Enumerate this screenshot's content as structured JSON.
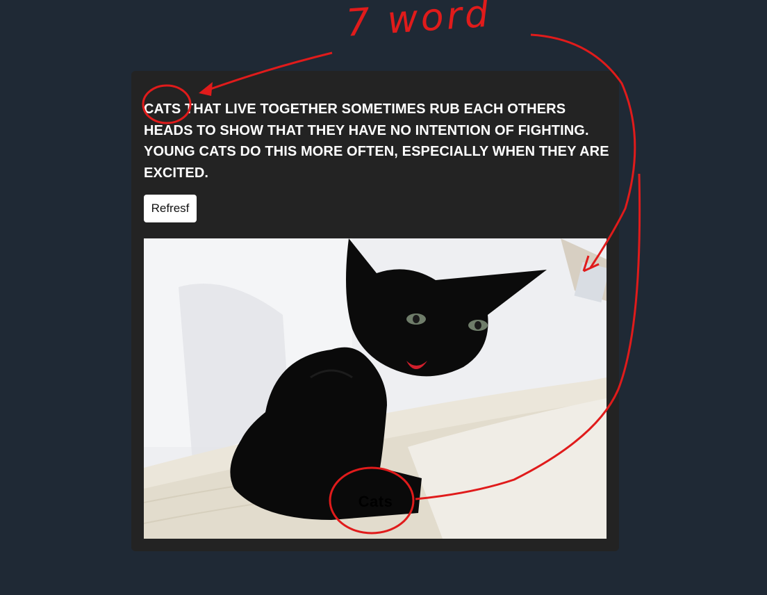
{
  "card": {
    "fact_text": "Cats that live together sometimes rub each others heads to show that they have no intention of fighting. Young cats do this more often, especially when they are excited.",
    "refresh_label": "Refresf",
    "image_caption": "Cats"
  },
  "annotation": {
    "note_text": "7 word",
    "color": "#e01b1b"
  },
  "colors": {
    "page_background": "#1f2935",
    "card_background": "#232323",
    "button_background": "#ffffff"
  }
}
